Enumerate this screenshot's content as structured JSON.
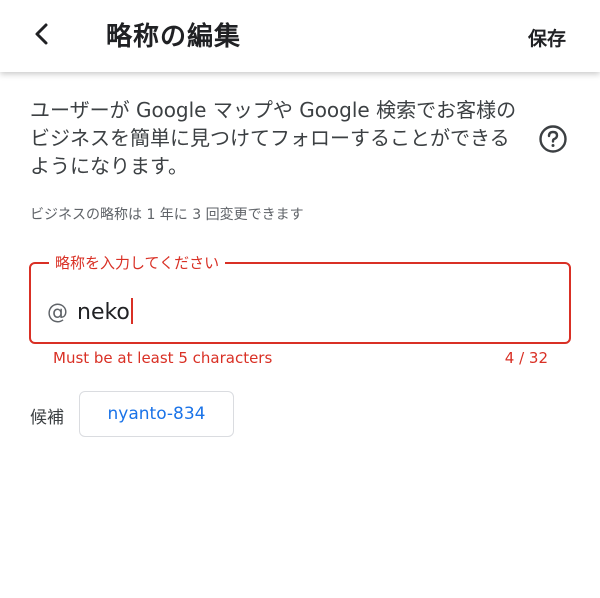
{
  "header": {
    "title": "略称の編集",
    "save_label": "保存"
  },
  "icons": {
    "back": "chevron-left-icon",
    "help": "help-circle-icon"
  },
  "description": "ユーザーが Google マップや Google 検索でお客様のビジネスを簡単に見つけてフォローすることができるようになります。",
  "note": "ビジネスの略称は 1 年に 3 回変更できます",
  "field": {
    "label": "略称を入力してください",
    "prefix": "@",
    "value": "neko",
    "error": "Must be at least 5 characters",
    "counter": "4 / 32"
  },
  "suggestions": {
    "label": "候補",
    "items": [
      "nyanto-834"
    ]
  },
  "colors": {
    "error": "#d93025",
    "link": "#1a73e8",
    "text": "#202124"
  }
}
